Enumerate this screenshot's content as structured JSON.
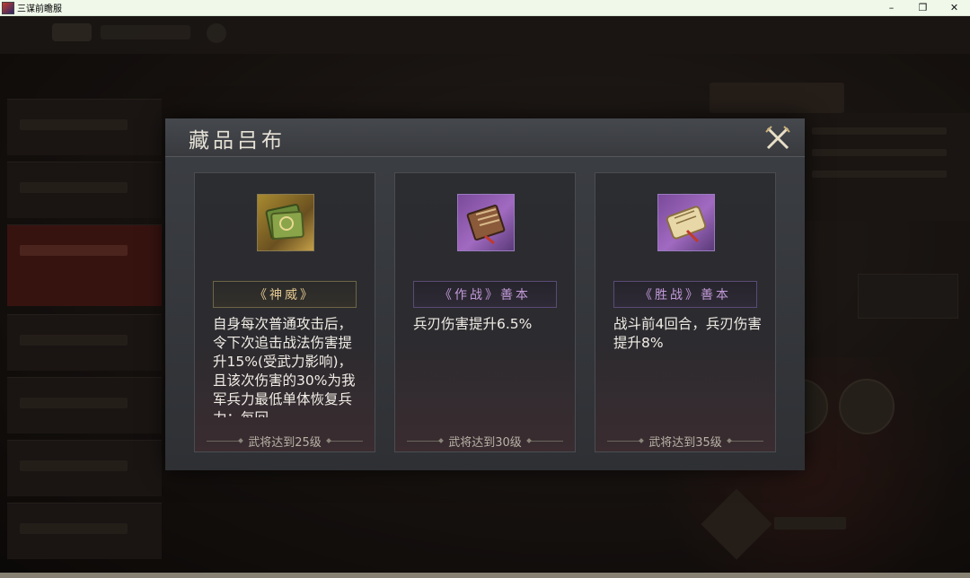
{
  "window": {
    "title": "三谋前瞻服",
    "minimize": "–",
    "restore": "❐",
    "close": "✕"
  },
  "dialog": {
    "title": "藏品吕布",
    "cards": [
      {
        "name": "《神威》",
        "icon": "gold-book-icon",
        "description": "自身每次普通攻击后，令下次追击战法伤害提升15%(受武力影响)，且该次伤害的30%为我军兵力最低单体恢复兵力；每回",
        "requirement": "武将达到25级"
      },
      {
        "name": "《作战》善本",
        "icon": "purple-book-icon",
        "description": "兵刃伤害提升6.5%",
        "requirement": "武将达到30级"
      },
      {
        "name": "《胜战》善本",
        "icon": "purple-scroll-icon",
        "description": "战斗前4回合，兵刃伤害提升8%",
        "requirement": "武将达到35级"
      }
    ]
  },
  "colors": {
    "gold_accent": "#e4c890",
    "purple_accent": "#c29ad8",
    "dialog_bg": "#35373b"
  }
}
